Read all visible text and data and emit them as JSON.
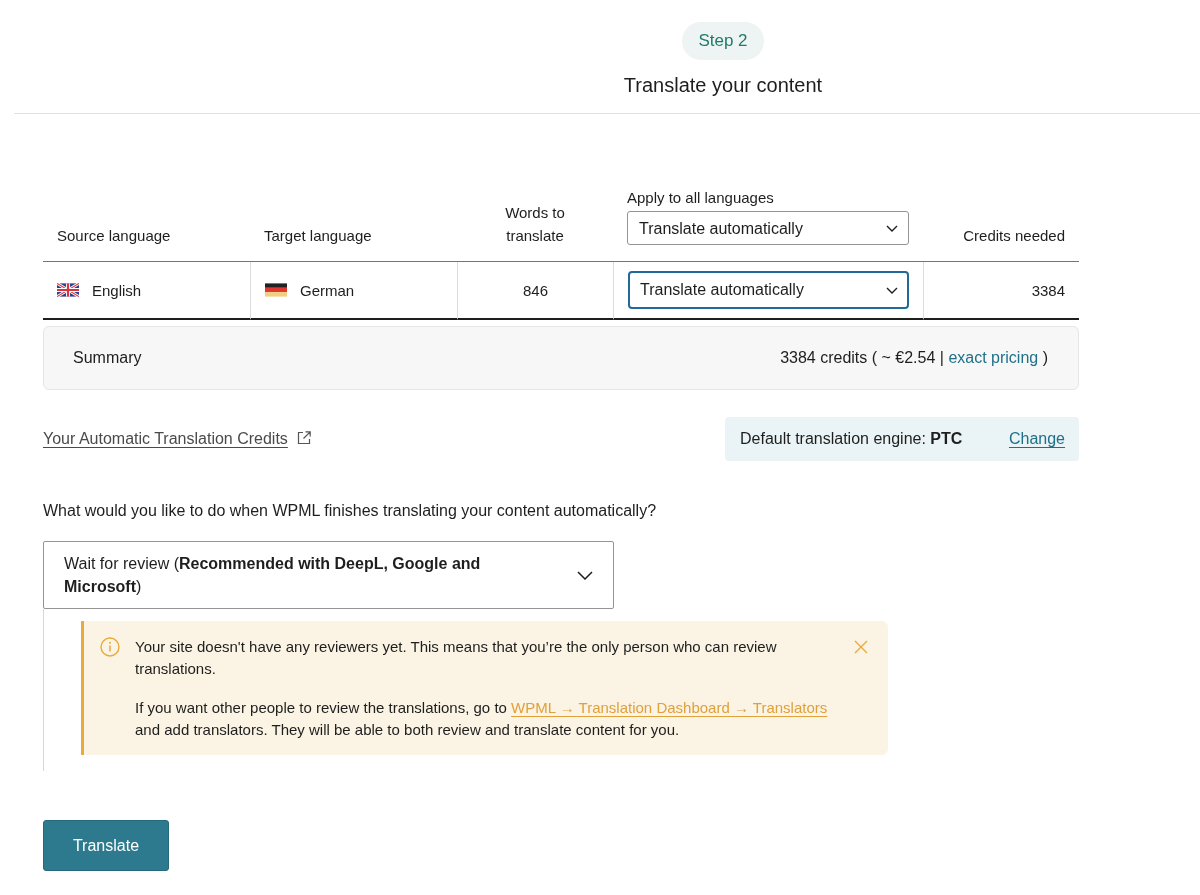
{
  "step": {
    "badge": "Step 2",
    "title": "Translate your content"
  },
  "table": {
    "columns": [
      {
        "kind": "text",
        "label": "Source language"
      },
      {
        "kind": "text",
        "label": "Target language"
      },
      {
        "kind": "text",
        "label": "Words to translate"
      },
      {
        "kind": "select",
        "label": "Apply to all languages",
        "value": "Translate automatically",
        "focused": false
      },
      {
        "kind": "text",
        "label": "Credits needed"
      }
    ],
    "rows": [
      {
        "source": "English",
        "target": "German",
        "words": "846",
        "method": {
          "value": "Translate automatically",
          "focused": true
        },
        "credits": "3384"
      }
    ]
  },
  "summary": {
    "label": "Summary",
    "text": "3384 credits ( ~ €2.54 |",
    "link": "exact pricing",
    "after": ")"
  },
  "credits_link": "Your Automatic Translation Credits",
  "engine": {
    "text": "Default translation engine: **PTC**",
    "link": "Change"
  },
  "question": "What would you like to do when WPML finishes translating your content automatically?",
  "review_select": {
    "value": "Wait for review (**Recommended with DeepL, Google and Microsoft**)",
    "focused": false
  },
  "notice": {
    "kind": "warning",
    "dismissible": true,
    "paragraphs": [
      {
        "text": "Your site doesn't have any reviewers yet. This means that you’re the only person who can review translations."
      },
      {
        "text": "If you want other people to review the translations, go to",
        "link": "WPML → Translation Dashboard → Translators",
        "after": "and add translators. They will be able to both review and translate content for you."
      }
    ]
  },
  "primary_button": "Translate"
}
